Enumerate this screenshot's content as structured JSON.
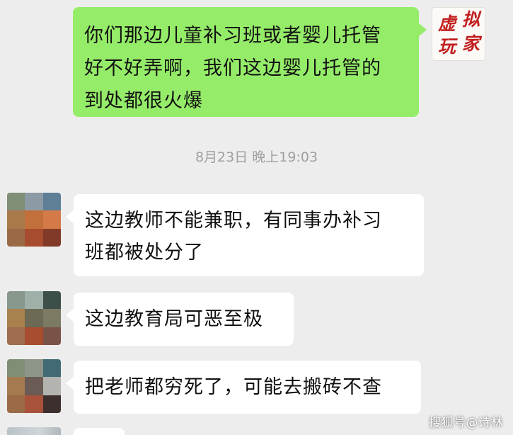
{
  "chat": {
    "outgoing": {
      "lines": [
        "你们那边儿童补习班或者婴儿托管",
        "好不好弄啊，我们这边婴儿托管的",
        "到处都很火爆"
      ]
    },
    "self_avatar": {
      "chars": [
        "虚",
        "拟",
        "玩",
        "家"
      ]
    },
    "timestamp": "8月23日 晚上19:03",
    "incoming": [
      {
        "lines": [
          "这边教师不能兼职，有同事办补习",
          "班都被处分了"
        ]
      },
      {
        "lines": [
          "这边教育局可恶至极"
        ]
      },
      {
        "lines": [
          "把老师都穷死了，可能去搬砖不查"
        ]
      }
    ]
  },
  "watermark": "搜狐号@诗林",
  "colors": {
    "background": "#ededed",
    "outgoing_bubble": "#95ec69",
    "incoming_bubble": "#ffffff",
    "timestamp": "#9f9f9f",
    "self_avatar_text": "#c21f1f"
  },
  "avatar_tiles": [
    [
      "#7f8e76",
      "#8c9aa5",
      "#5e7f95",
      "#a87a4b",
      "#c36f3c",
      "#d47a48",
      "#9a6a47",
      "#a84c2f",
      "#813a27"
    ],
    [
      "#88978c",
      "#9fb0a8",
      "#3c4f48",
      "#a8814e",
      "#6c6a54",
      "#7c7a62",
      "#9e6d4d",
      "#a84d2f",
      "#7a5348"
    ],
    [
      "#7f8e76",
      "#8d9589",
      "#426a74",
      "#a57a4e",
      "#6a5b55",
      "#b3b3b0",
      "#9b6a47",
      "#a8523b",
      "#3e2f2f"
    ]
  ]
}
